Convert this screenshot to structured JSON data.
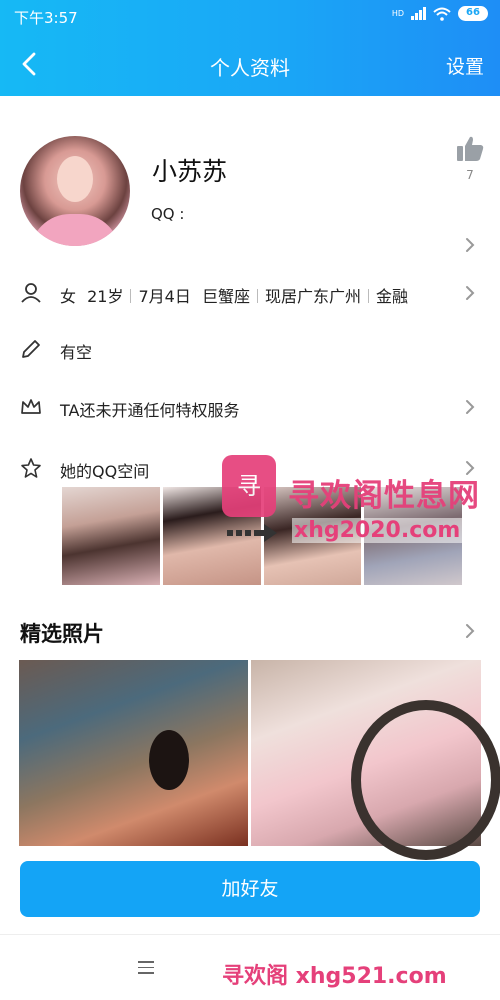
{
  "status_bar": {
    "time": "下午3:57",
    "network": "HD",
    "battery": "66"
  },
  "header": {
    "title": "个人资料",
    "settings_label": "设置"
  },
  "profile": {
    "name": "小苏苏",
    "qq_label": "QQ :",
    "like_count": "7"
  },
  "info": {
    "gender": "女",
    "age": "21岁",
    "birthday": "7月4日",
    "zodiac": "巨蟹座",
    "location": "现居广东广州",
    "industry": "金融"
  },
  "status_text": "有空",
  "privilege_text": "TA还未开通任何特权服务",
  "qzone_label": "她的QQ空间",
  "featured_title": "精选照片",
  "add_friend_label": "加好友",
  "watermark": {
    "logo_char": "寻",
    "site_name": "寻欢阁性息网",
    "url": "xhg2020.com",
    "bottom": "寻欢阁 xhg521.com"
  },
  "colors": {
    "header_start": "#16b9f5",
    "header_end": "#1e8ef6",
    "primary_button": "#14a4f6",
    "watermark": "#e5407a"
  }
}
